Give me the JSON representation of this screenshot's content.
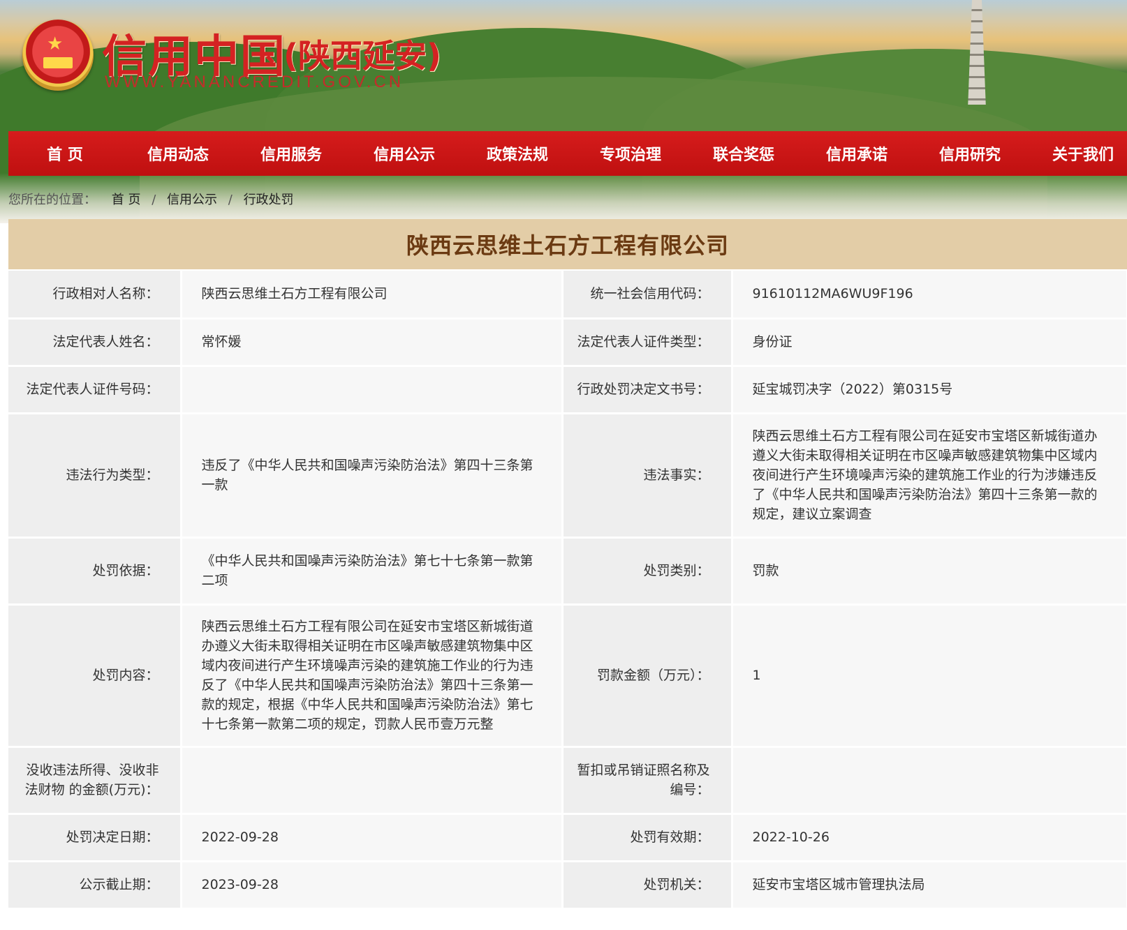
{
  "site": {
    "title": "信用中国",
    "region": "(陕西延安)",
    "url": "WWW.YANANCREDIT.GOV.CN"
  },
  "nav": {
    "items": [
      "首 页",
      "信用动态",
      "信用服务",
      "信用公示",
      "政策法规",
      "专项治理",
      "联合奖惩",
      "信用承诺",
      "信用研究",
      "关于我们"
    ]
  },
  "breadcrumb": {
    "lead": "您所在的位置：",
    "home": "首 页",
    "section": "信用公示",
    "current": "行政处罚",
    "separator": "/"
  },
  "company": {
    "name": "陕西云思维土石方工程有限公司"
  },
  "details": {
    "r1": {
      "l1": "行政相对人名称：",
      "v1": "陕西云思维土石方工程有限公司",
      "l2": "统一社会信用代码：",
      "v2": "91610112MA6WU9F196"
    },
    "r2": {
      "l1": "法定代表人姓名：",
      "v1": "常怀媛",
      "l2": "法定代表人证件类型：",
      "v2": "身份证"
    },
    "r3": {
      "l1": "法定代表人证件号码：",
      "v1": "",
      "l2": "行政处罚决定文书号：",
      "v2": "延宝城罚决字（2022）第0315号"
    },
    "r4": {
      "l1": "违法行为类型：",
      "v1": "违反了《中华人民共和国噪声污染防治法》第四十三条第一款",
      "l2": "违法事实：",
      "v2": "陕西云思维土石方工程有限公司在延安市宝塔区新城街道办遵义大街未取得相关证明在市区噪声敏感建筑物集中区域内夜间进行产生环境噪声污染的建筑施工作业的行为涉嫌违反了《中华人民共和国噪声污染防治法》第四十三条第一款的规定，建议立案调查"
    },
    "r5": {
      "l1": "处罚依据：",
      "v1": "《中华人民共和国噪声污染防治法》第七十七条第一款第二项",
      "l2": "处罚类别：",
      "v2": "罚款"
    },
    "r6": {
      "l1": "处罚内容：",
      "v1": "陕西云思维土石方工程有限公司在延安市宝塔区新城街道办遵义大街未取得相关证明在市区噪声敏感建筑物集中区域内夜间进行产生环境噪声污染的建筑施工作业的行为违反了《中华人民共和国噪声污染防治法》第四十三条第一款的规定，根据《中华人民共和国噪声污染防治法》第七十七条第一款第二项的规定，罚款人民币壹万元整",
      "l2": "罚款金额（万元）：",
      "v2": "1"
    },
    "r7": {
      "l1": "没收违法所得、没收非法财物 的金额(万元)：",
      "v1": "",
      "l2": "暂扣或吊销证照名称及编号：",
      "v2": ""
    },
    "r8": {
      "l1": "处罚决定日期：",
      "v1": "2022-09-28",
      "l2": "处罚有效期：",
      "v2": "2022-10-26"
    },
    "r9": {
      "l1": "公示截止期：",
      "v1": "2023-09-28",
      "l2": "处罚机关：",
      "v2": "延安市宝塔区城市管理执法局"
    }
  }
}
